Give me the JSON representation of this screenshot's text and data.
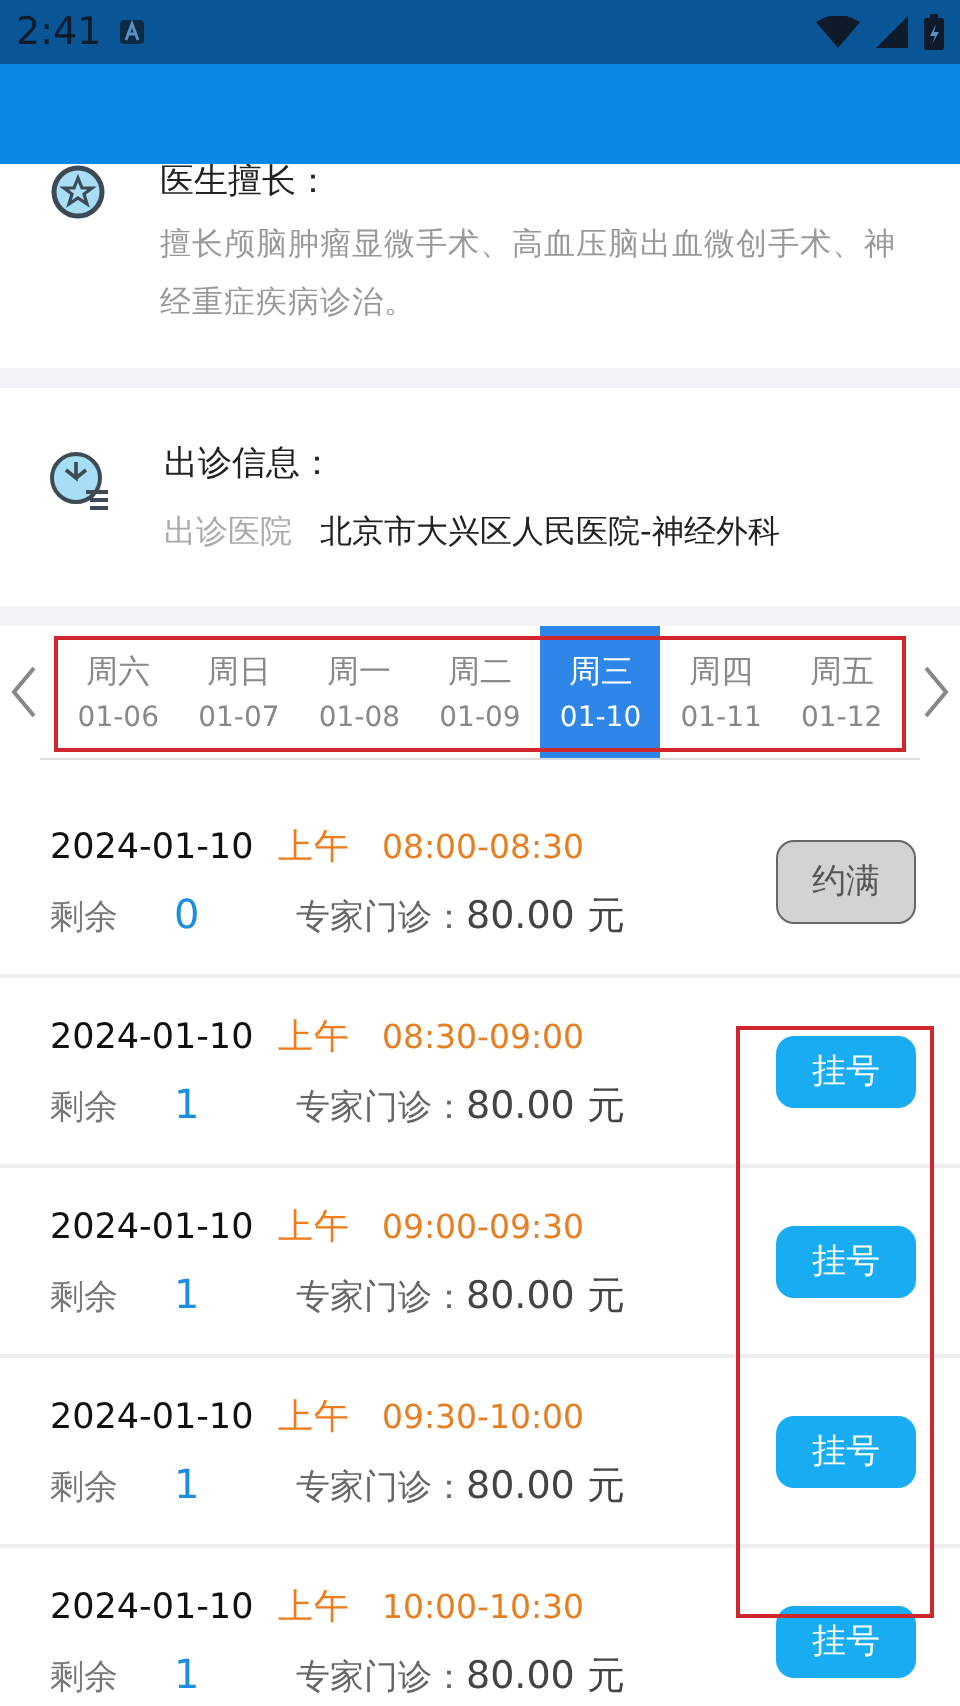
{
  "status_bar": {
    "time": "2:41"
  },
  "specialty": {
    "title": "医生擅长：",
    "text": "擅长颅脑肿瘤显微手术、高血压脑出血微创手术、神经重症疾病诊治。"
  },
  "visit_info": {
    "title": "出诊信息：",
    "label": "出诊医院",
    "value": "北京市大兴区人民医院-神经外科"
  },
  "date_strip": {
    "outlined": true,
    "days": [
      {
        "weekday": "周六",
        "date": "01-06",
        "selected": false
      },
      {
        "weekday": "周日",
        "date": "01-07",
        "selected": false
      },
      {
        "weekday": "周一",
        "date": "01-08",
        "selected": false
      },
      {
        "weekday": "周二",
        "date": "01-09",
        "selected": false
      },
      {
        "weekday": "周三",
        "date": "01-10",
        "selected": true
      },
      {
        "weekday": "周四",
        "date": "01-11",
        "selected": false
      },
      {
        "weekday": "周五",
        "date": "01-12",
        "selected": false
      }
    ]
  },
  "slots_buttons_outlined": true,
  "slots": [
    {
      "date": "2024-01-10",
      "period": "上午",
      "time": "08:00-08:30",
      "remaining_label": "剩余",
      "remaining": "0",
      "fee_label": "专家门诊：",
      "fee": "80.00 元",
      "button": "约满",
      "available": false
    },
    {
      "date": "2024-01-10",
      "period": "上午",
      "time": "08:30-09:00",
      "remaining_label": "剩余",
      "remaining": "1",
      "fee_label": "专家门诊：",
      "fee": "80.00 元",
      "button": "挂号",
      "available": true
    },
    {
      "date": "2024-01-10",
      "period": "上午",
      "time": "09:00-09:30",
      "remaining_label": "剩余",
      "remaining": "1",
      "fee_label": "专家门诊：",
      "fee": "80.00 元",
      "button": "挂号",
      "available": true
    },
    {
      "date": "2024-01-10",
      "period": "上午",
      "time": "09:30-10:00",
      "remaining_label": "剩余",
      "remaining": "1",
      "fee_label": "专家门诊：",
      "fee": "80.00 元",
      "button": "挂号",
      "available": true
    },
    {
      "date": "2024-01-10",
      "period": "上午",
      "time": "10:00-10:30",
      "remaining_label": "剩余",
      "remaining": "1",
      "fee_label": "专家门诊：",
      "fee": "80.00 元",
      "button": "挂号",
      "available": true
    }
  ]
}
